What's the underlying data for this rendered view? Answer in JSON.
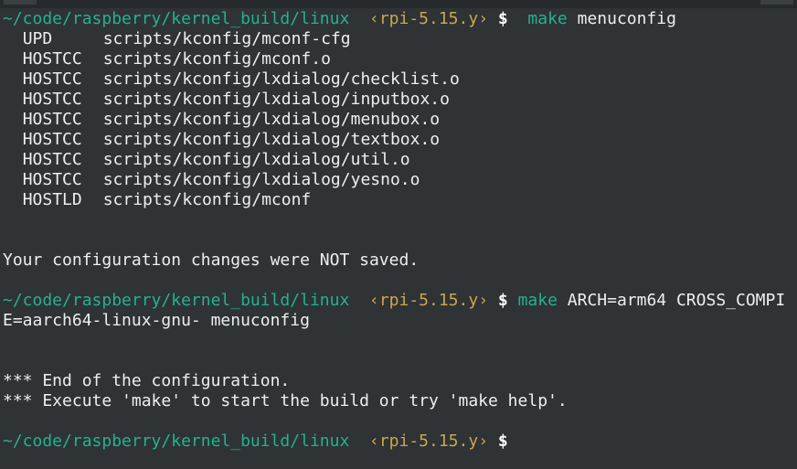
{
  "terminal": {
    "prompt": {
      "path": "~/code/raspberry/kernel_build/linux",
      "branch": "‹rpi-5.15.y›",
      "symbol": "$"
    },
    "first_command": {
      "program": "make",
      "args": "menuconfig"
    },
    "build_output": [
      {
        "tag": "UPD",
        "file": "scripts/kconfig/mconf-cfg"
      },
      {
        "tag": "HOSTCC",
        "file": "scripts/kconfig/mconf.o"
      },
      {
        "tag": "HOSTCC",
        "file": "scripts/kconfig/lxdialog/checklist.o"
      },
      {
        "tag": "HOSTCC",
        "file": "scripts/kconfig/lxdialog/inputbox.o"
      },
      {
        "tag": "HOSTCC",
        "file": "scripts/kconfig/lxdialog/menubox.o"
      },
      {
        "tag": "HOSTCC",
        "file": "scripts/kconfig/lxdialog/textbox.o"
      },
      {
        "tag": "HOSTCC",
        "file": "scripts/kconfig/lxdialog/util.o"
      },
      {
        "tag": "HOSTCC",
        "file": "scripts/kconfig/lxdialog/yesno.o"
      },
      {
        "tag": "HOSTLD",
        "file": "scripts/kconfig/mconf"
      }
    ],
    "not_saved_message": "Your configuration changes were NOT saved.",
    "second_command": {
      "program": "make",
      "args_line1": "ARCH=arm64 CROSS_COMPI",
      "args_line2": "E=aarch64-linux-gnu- menuconfig"
    },
    "end_messages": [
      "*** End of the configuration.",
      "*** Execute 'make' to start the build or try 'make help'."
    ]
  }
}
